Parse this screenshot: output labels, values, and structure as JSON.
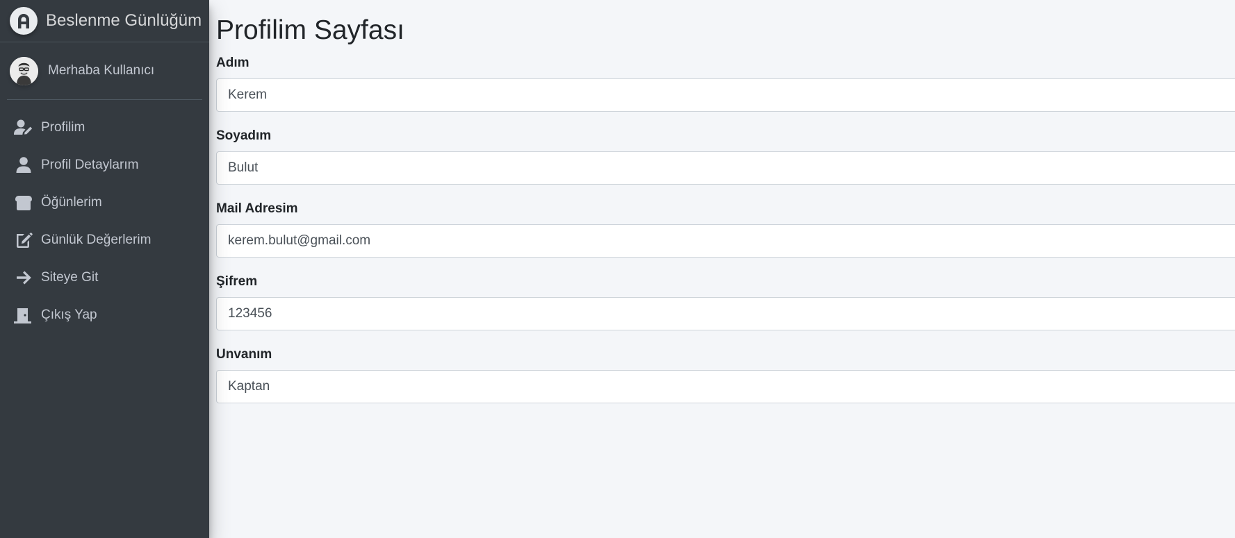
{
  "brand": {
    "title": "Beslenme Günlüğüm",
    "logo_icon": "brand-logo-icon"
  },
  "user": {
    "greeting": "Merhaba Kullanıcı",
    "avatar_icon": "user-avatar"
  },
  "sidebar": {
    "items": [
      {
        "label": "Profilim",
        "icon": "user-edit-icon"
      },
      {
        "label": "Profil Detaylarım",
        "icon": "user-icon"
      },
      {
        "label": "Öğünlerim",
        "icon": "bread-icon"
      },
      {
        "label": "Günlük Değerlerim",
        "icon": "edit-icon"
      },
      {
        "label": "Siteye Git",
        "icon": "arrow-right-icon"
      },
      {
        "label": "Çıkış Yap",
        "icon": "door-icon"
      }
    ]
  },
  "page": {
    "title": "Profilim Sayfası"
  },
  "form": {
    "fields": [
      {
        "label": "Adım",
        "value": "Kerem"
      },
      {
        "label": "Soyadım",
        "value": "Bulut"
      },
      {
        "label": "Mail Adresim",
        "value": "kerem.bulut@gmail.com"
      },
      {
        "label": "Şifrem",
        "value": "123456"
      },
      {
        "label": "Unvanım",
        "value": "Kaptan"
      }
    ]
  },
  "colors": {
    "sidebar_bg": "#343a40",
    "sidebar_text": "#c2c7d0",
    "page_bg": "#f4f6f9",
    "input_border": "#ced4da"
  }
}
